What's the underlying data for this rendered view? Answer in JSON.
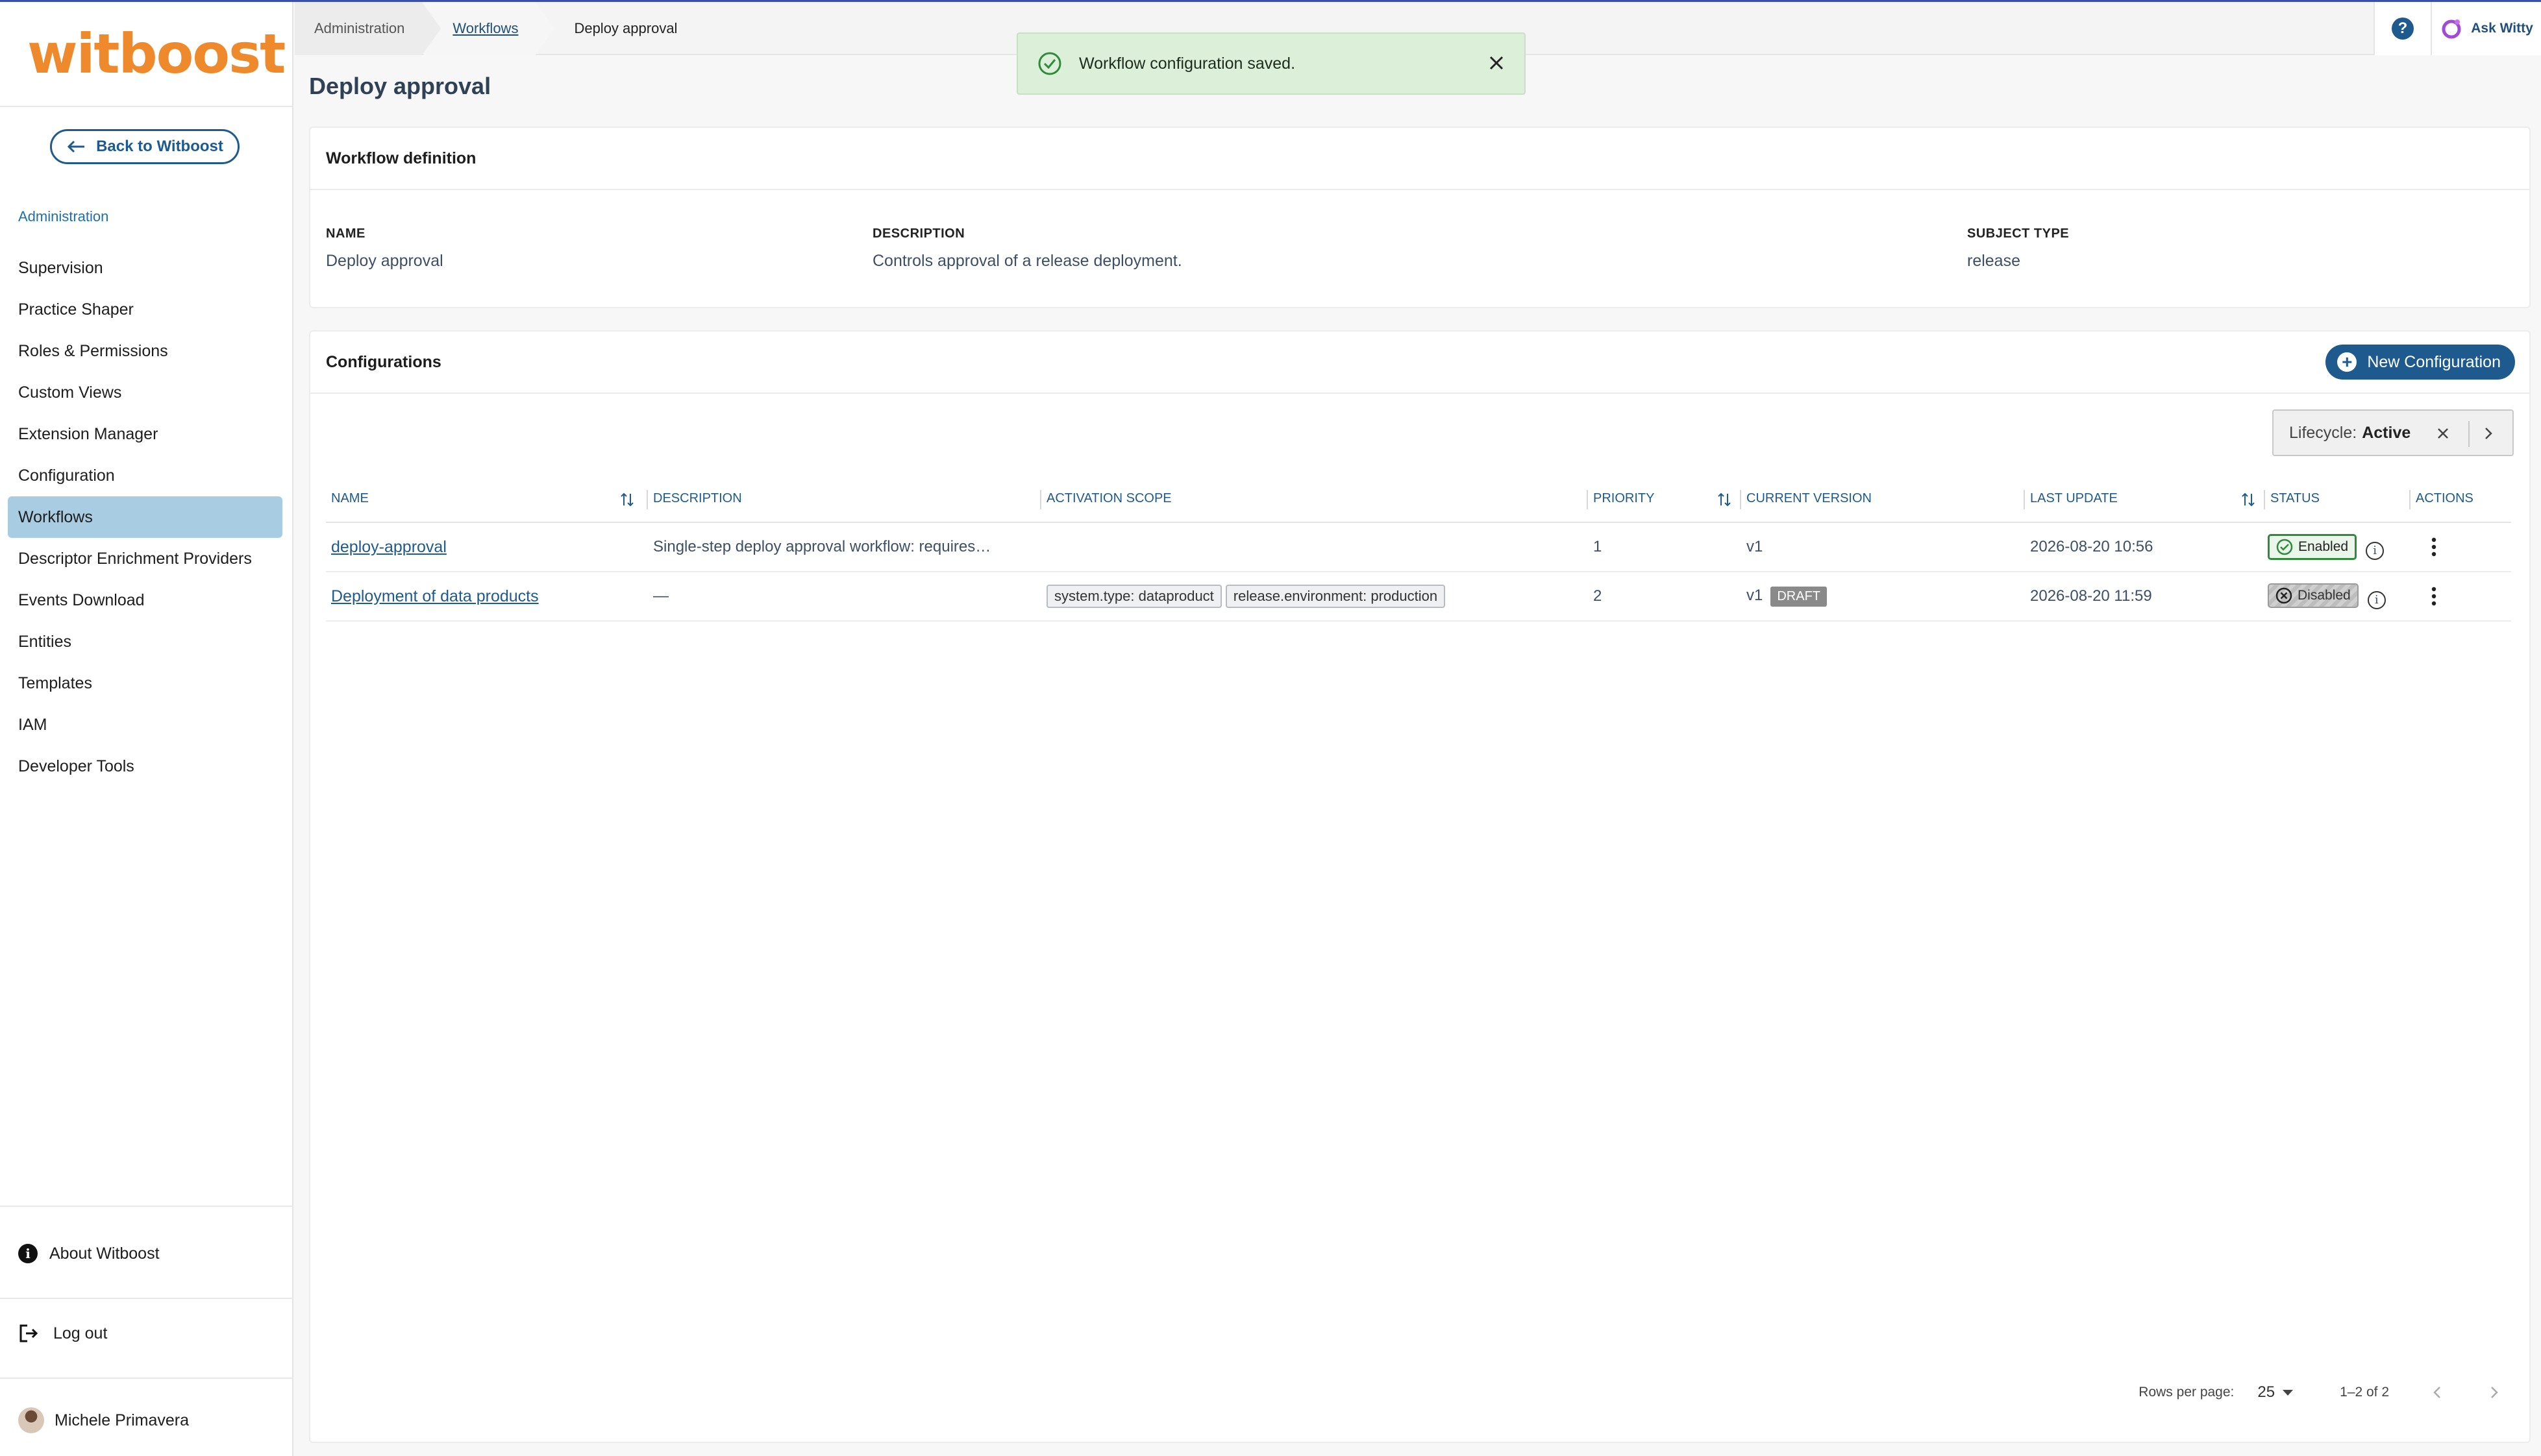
{
  "sidebar": {
    "logo_text": "witboost",
    "back_label": "Back to Witboost",
    "section_title": "Administration",
    "items": [
      {
        "label": "Supervision",
        "active": false
      },
      {
        "label": "Practice Shaper",
        "active": false
      },
      {
        "label": "Roles & Permissions",
        "active": false
      },
      {
        "label": "Custom Views",
        "active": false
      },
      {
        "label": "Extension Manager",
        "active": false
      },
      {
        "label": "Configuration",
        "active": false
      },
      {
        "label": "Workflows",
        "active": true
      },
      {
        "label": "Descriptor Enrichment Providers",
        "active": false
      },
      {
        "label": "Events Download",
        "active": false
      },
      {
        "label": "Entities",
        "active": false
      },
      {
        "label": "Templates",
        "active": false
      },
      {
        "label": "IAM",
        "active": false
      },
      {
        "label": "Developer Tools",
        "active": false
      }
    ],
    "about_label": "About Witboost",
    "logout_label": "Log out",
    "user_name": "Michele Primavera"
  },
  "breadcrumb": {
    "items": [
      "Administration",
      "Workflows",
      "Deploy approval"
    ]
  },
  "topbar": {
    "help_glyph": "?",
    "ask_label": "Ask Witty"
  },
  "toast": {
    "message": "Workflow configuration saved."
  },
  "page": {
    "title": "Deploy approval"
  },
  "definition": {
    "heading": "Workflow definition",
    "name_label": "NAME",
    "name_value": "Deploy approval",
    "description_label": "DESCRIPTION",
    "description_value": "Controls approval of a release deployment.",
    "subject_label": "SUBJECT TYPE",
    "subject_value": "release"
  },
  "configurations": {
    "heading": "Configurations",
    "new_button": "New Configuration",
    "filter_label": "Lifecycle:",
    "filter_value": "Active",
    "columns": [
      "NAME",
      "DESCRIPTION",
      "ACTIVATION SCOPE",
      "PRIORITY",
      "CURRENT VERSION",
      "LAST UPDATE",
      "STATUS",
      "ACTIONS"
    ],
    "rows": [
      {
        "name": "deploy-approval",
        "description": "Single-step deploy approval workflow: requires…",
        "scope": [],
        "priority": "1",
        "version": "v1",
        "draft": "",
        "last_update": "2026-08-20 10:56",
        "status": "Enabled"
      },
      {
        "name": "Deployment of data products",
        "description": "—",
        "scope": [
          "system.type: dataproduct",
          "release.environment: production"
        ],
        "priority": "2",
        "version": "v1",
        "draft": "DRAFT",
        "last_update": "2026-08-20 11:59",
        "status": "Disabled"
      }
    ],
    "pagination": {
      "rows_per_page_label": "Rows per page:",
      "rows_per_page": "25",
      "range": "1–2 of 2"
    }
  },
  "colors": {
    "primary": "#1f5a8f",
    "brand": "#ee8a2c",
    "active_nav": "#a8cde2",
    "toast_bg": "#dcefd9",
    "enabled": "#2f8a3a"
  }
}
